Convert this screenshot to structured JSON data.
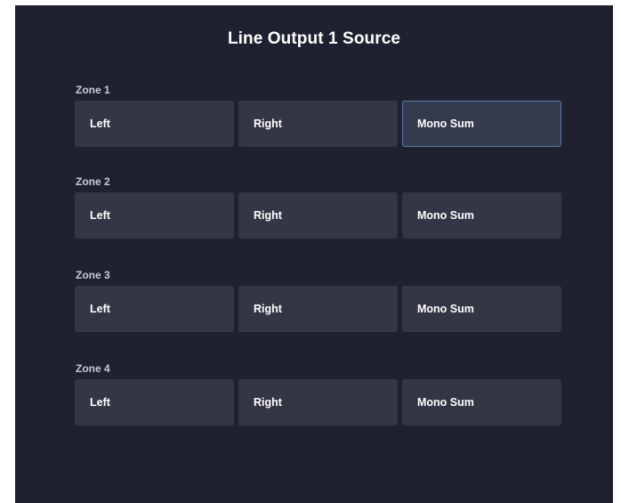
{
  "title": "Line Output 1 Source",
  "zones": [
    {
      "label": "Zone 1",
      "options": [
        "Left",
        "Right",
        "Mono Sum"
      ],
      "selected": "Mono Sum"
    },
    {
      "label": "Zone 2",
      "options": [
        "Left",
        "Right",
        "Mono Sum"
      ],
      "selected": ""
    },
    {
      "label": "Zone 3",
      "options": [
        "Left",
        "Right",
        "Mono Sum"
      ],
      "selected": ""
    },
    {
      "label": "Zone 4",
      "options": [
        "Left",
        "Right",
        "Mono Sum"
      ],
      "selected": ""
    }
  ],
  "colors": {
    "panel_background": "#1f2130",
    "button_background": "#343646",
    "selected_border": "#5b77a8"
  }
}
